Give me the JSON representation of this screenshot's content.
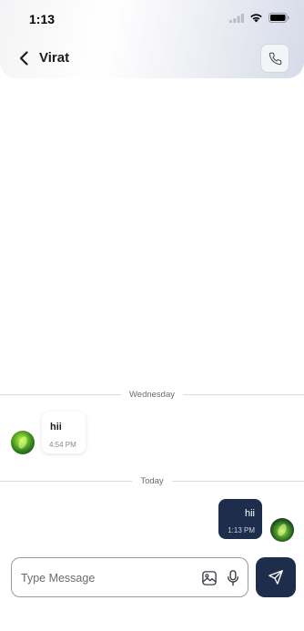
{
  "status_bar": {
    "time": "1:13"
  },
  "header": {
    "contact_name": "Virat",
    "back_icon": "chevron-left-icon",
    "call_icon": "phone-icon"
  },
  "dividers": [
    {
      "label": "Wednesday"
    },
    {
      "label": "Today"
    }
  ],
  "messages": [
    {
      "direction": "incoming",
      "text": "hii",
      "time": "4:54 PM"
    },
    {
      "direction": "outgoing",
      "text": "hii",
      "time": "1:13 PM"
    }
  ],
  "composer": {
    "placeholder": "Type Message",
    "value": ""
  },
  "colors": {
    "accent": "#1f2d4d"
  }
}
